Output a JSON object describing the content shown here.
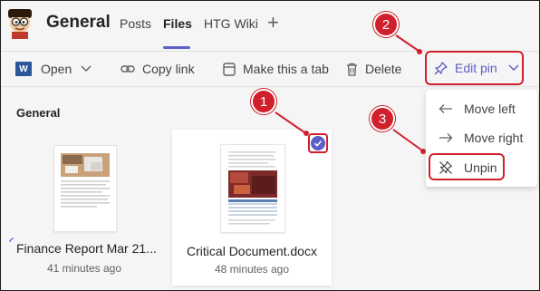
{
  "header": {
    "channel_title": "General",
    "tabs": [
      {
        "label": "Posts",
        "active": false
      },
      {
        "label": "Files",
        "active": true
      },
      {
        "label": "HTG Wiki",
        "active": false
      }
    ],
    "add_tab_symbol": "+"
  },
  "toolbar": {
    "open_label": "Open",
    "word_icon_letter": "W",
    "copy_link_label": "Copy link",
    "make_tab_label": "Make this a tab",
    "delete_label": "Delete",
    "edit_pin_label": "Edit pin"
  },
  "section": {
    "heading": "General"
  },
  "files": [
    {
      "name": "Finance Report Mar 21...",
      "time": "41 minutes ago",
      "selected": false
    },
    {
      "name": "Critical Document.docx",
      "time": "48 minutes ago",
      "selected": true
    }
  ],
  "pin_menu": {
    "items": [
      {
        "label": "Move left",
        "icon": "arrow-left-icon"
      },
      {
        "label": "Move right",
        "icon": "arrow-right-icon"
      },
      {
        "label": "Unpin",
        "icon": "unpin-icon"
      }
    ]
  },
  "callouts": [
    "1",
    "2",
    "3"
  ],
  "colors": {
    "accent": "#5b5fc7",
    "callout_red": "#d0202c",
    "word_blue": "#2b579a"
  }
}
